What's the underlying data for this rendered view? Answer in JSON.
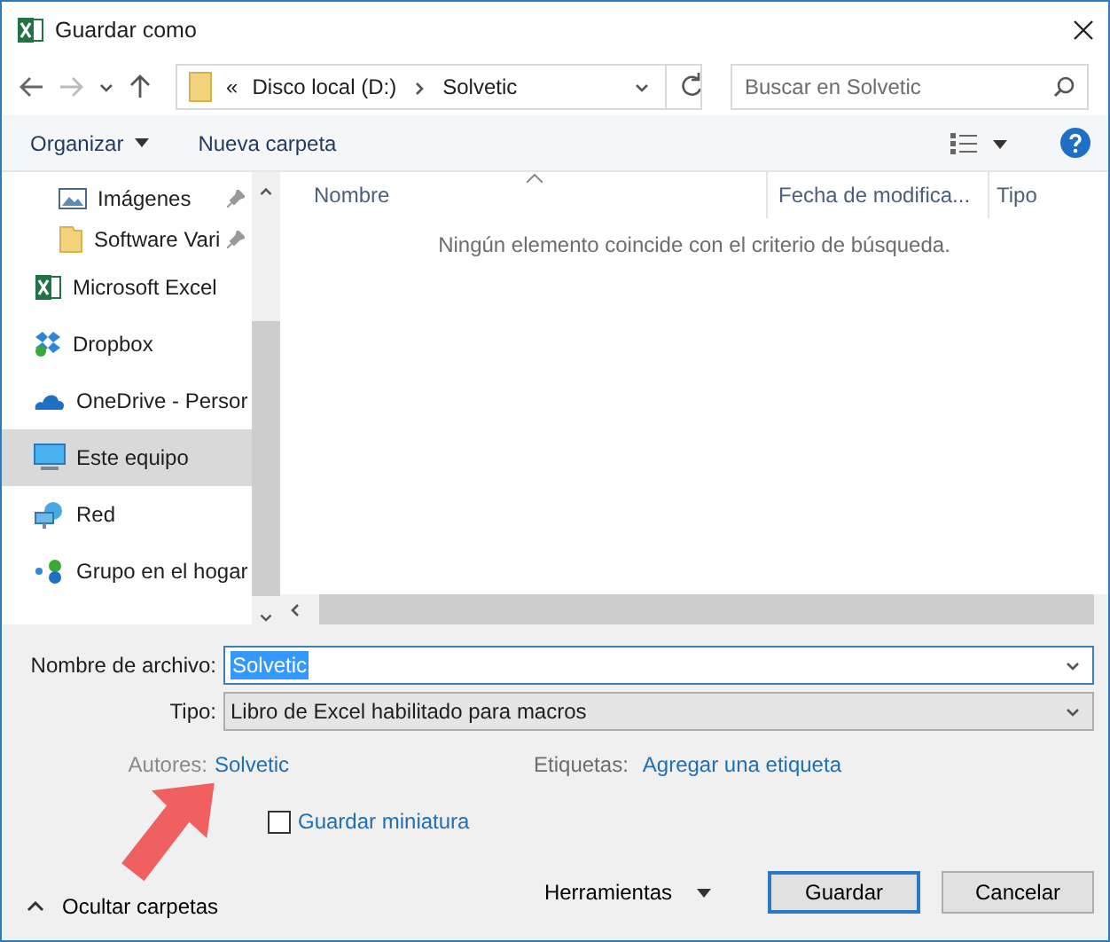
{
  "window": {
    "title": "Guardar como"
  },
  "address_bar": {
    "overflow_mark": "«",
    "path": [
      "Disco local (D:)",
      "Solvetic"
    ]
  },
  "search": {
    "placeholder": "Buscar en Solvetic"
  },
  "toolbar": {
    "organize": "Organizar",
    "new_folder": "Nueva carpeta"
  },
  "sidebar": {
    "items": [
      {
        "label": "Imágenes",
        "kind": "pictures",
        "pinned": true,
        "selected": false
      },
      {
        "label": "Software Vari",
        "kind": "folder",
        "pinned": true,
        "selected": false
      },
      {
        "label": "Microsoft Excel",
        "kind": "excel",
        "pinned": false,
        "selected": false
      },
      {
        "label": "Dropbox",
        "kind": "dropbox",
        "pinned": false,
        "selected": false
      },
      {
        "label": "OneDrive - Persor",
        "kind": "onedrive",
        "pinned": false,
        "selected": false
      },
      {
        "label": "Este equipo",
        "kind": "computer",
        "pinned": false,
        "selected": true
      },
      {
        "label": "Red",
        "kind": "network",
        "pinned": false,
        "selected": false
      },
      {
        "label": "Grupo en el hogar",
        "kind": "homegroup",
        "pinned": false,
        "selected": false
      }
    ]
  },
  "file_list": {
    "columns": [
      "Nombre",
      "Fecha de modifica...",
      "Tipo"
    ],
    "empty_message": "Ningún elemento coincide con el criterio de búsqueda."
  },
  "form": {
    "filename_label": "Nombre de archivo:",
    "filename": "Solvetic",
    "type_label": "Tipo:",
    "type": "Libro de Excel habilitado para macros",
    "authors_label": "Autores:",
    "authors": "Solvetic",
    "tags_label": "Etiquetas:",
    "tags": "Agregar una etiqueta",
    "thumbnail": {
      "label": "Guardar miniatura",
      "checked": false
    }
  },
  "footer": {
    "hide_folders": "Ocultar carpetas",
    "tools": "Herramientas",
    "buttons": [
      {
        "label": "Guardar",
        "primary": true
      },
      {
        "label": "Cancelar",
        "primary": false
      }
    ]
  }
}
